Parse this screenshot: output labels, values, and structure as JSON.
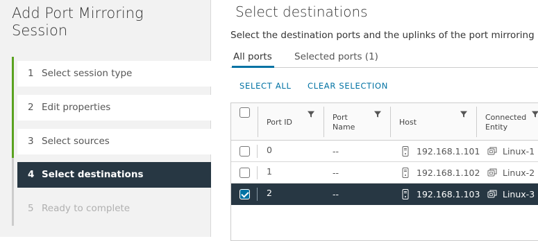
{
  "wizard": {
    "title": "Add Port Mirroring Session",
    "steps": [
      {
        "num": "1",
        "label": "Select session type",
        "state": "completed"
      },
      {
        "num": "2",
        "label": "Edit properties",
        "state": "completed"
      },
      {
        "num": "3",
        "label": "Select sources",
        "state": "completed"
      },
      {
        "num": "4",
        "label": "Select destinations",
        "state": "current"
      },
      {
        "num": "5",
        "label": "Ready to complete",
        "state": "disabled"
      }
    ]
  },
  "main": {
    "title": "Select destinations",
    "subtitle": "Select the destination ports and the uplinks of the port mirroring",
    "tabs": [
      {
        "label": "All ports",
        "active": true
      },
      {
        "label": "Selected ports (1)",
        "active": false
      }
    ],
    "actions": {
      "select_all": "SELECT ALL",
      "clear_selection": "CLEAR SELECTION"
    },
    "grid": {
      "columns": [
        "Port ID",
        "Port Name",
        "Host",
        "Connected Entity"
      ],
      "rows": [
        {
          "port_id": "0",
          "port_name": "--",
          "host": "192.168.1.101",
          "entity": "Linux-1",
          "selected": false
        },
        {
          "port_id": "1",
          "port_name": "--",
          "host": "192.168.1.102",
          "entity": "Linux-2",
          "selected": false
        },
        {
          "port_id": "2",
          "port_name": "--",
          "host": "192.168.1.103",
          "entity": "Linux-3",
          "selected": true
        }
      ]
    }
  },
  "colors": {
    "completed_rail": "#5aa220",
    "pending_rail": "#cccccc",
    "current_step_bg": "#273743",
    "accent": "#0072a3"
  },
  "icons": {
    "filter": "filter-icon",
    "host": "host-icon",
    "vm": "vm-icon"
  }
}
